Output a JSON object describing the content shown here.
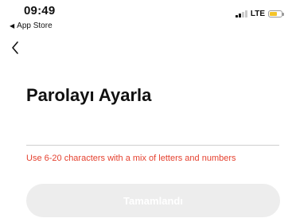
{
  "status_bar": {
    "time": "09:49",
    "back_app_label": "App Store",
    "back_app_icon": "left-triangle-icon",
    "network": "LTE",
    "signal_bars_active": 2,
    "signal_bars_total": 4,
    "battery_level_percent": 62,
    "battery_color": "#f4c42a"
  },
  "nav": {
    "back_icon": "chevron-left-icon"
  },
  "main": {
    "title": "Parolayı Ayarla",
    "password_field": {
      "value": "",
      "placeholder": ""
    },
    "hint": "Use 6-20 characters with a mix of letters and numbers",
    "hint_color": "#e5412f",
    "done_button_label": "Tamamlandı",
    "done_button_enabled": false
  }
}
